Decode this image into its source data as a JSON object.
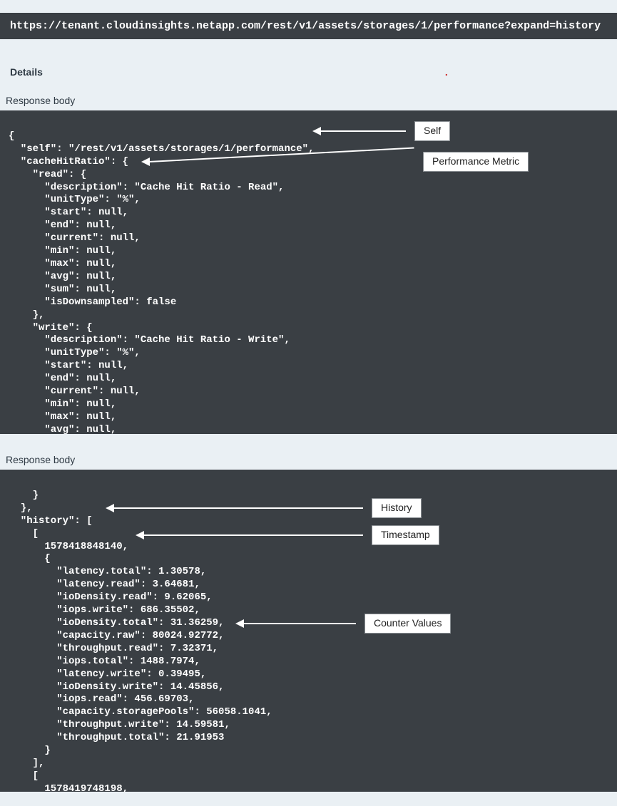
{
  "url": "https://tenant.cloudinsights.netapp.com/rest/v1/assets/storages/1/performance?expand=history",
  "labels": {
    "details": "Details",
    "responseBody": "Response body"
  },
  "annotations": {
    "self": "Self",
    "performanceMetric": "Performance Metric",
    "history": "History",
    "timestamp": "Timestamp",
    "counterValues": "Counter Values"
  },
  "codeTop": "{\n  \"self\": \"/rest/v1/assets/storages/1/performance\",\n  \"cacheHitRatio\": {\n    \"read\": {\n      \"description\": \"Cache Hit Ratio - Read\",\n      \"unitType\": \"%\",\n      \"start\": null,\n      \"end\": null,\n      \"current\": null,\n      \"min\": null,\n      \"max\": null,\n      \"avg\": null,\n      \"sum\": null,\n      \"isDownsampled\": false\n    },\n    \"write\": {\n      \"description\": \"Cache Hit Ratio - Write\",\n      \"unitType\": \"%\",\n      \"start\": null,\n      \"end\": null,\n      \"current\": null,\n      \"min\": null,\n      \"max\": null,\n      \"avg\": null,",
  "codeBottom": "    }\n  },\n  \"history\": [\n    [\n      1578418848140,\n      {\n        \"latency.total\": 1.30578,\n        \"latency.read\": 3.64681,\n        \"ioDensity.read\": 9.62065,\n        \"iops.write\": 686.35502,\n        \"ioDensity.total\": 31.36259,\n        \"capacity.raw\": 80024.92772,\n        \"throughput.read\": 7.32371,\n        \"iops.total\": 1488.7974,\n        \"latency.write\": 0.39495,\n        \"ioDensity.write\": 14.45856,\n        \"iops.read\": 456.69703,\n        \"capacity.storagePools\": 56058.1041,\n        \"throughput.write\": 14.59581,\n        \"throughput.total\": 21.91953\n      }\n    ],\n    [\n      1578419748198,\n      {"
}
